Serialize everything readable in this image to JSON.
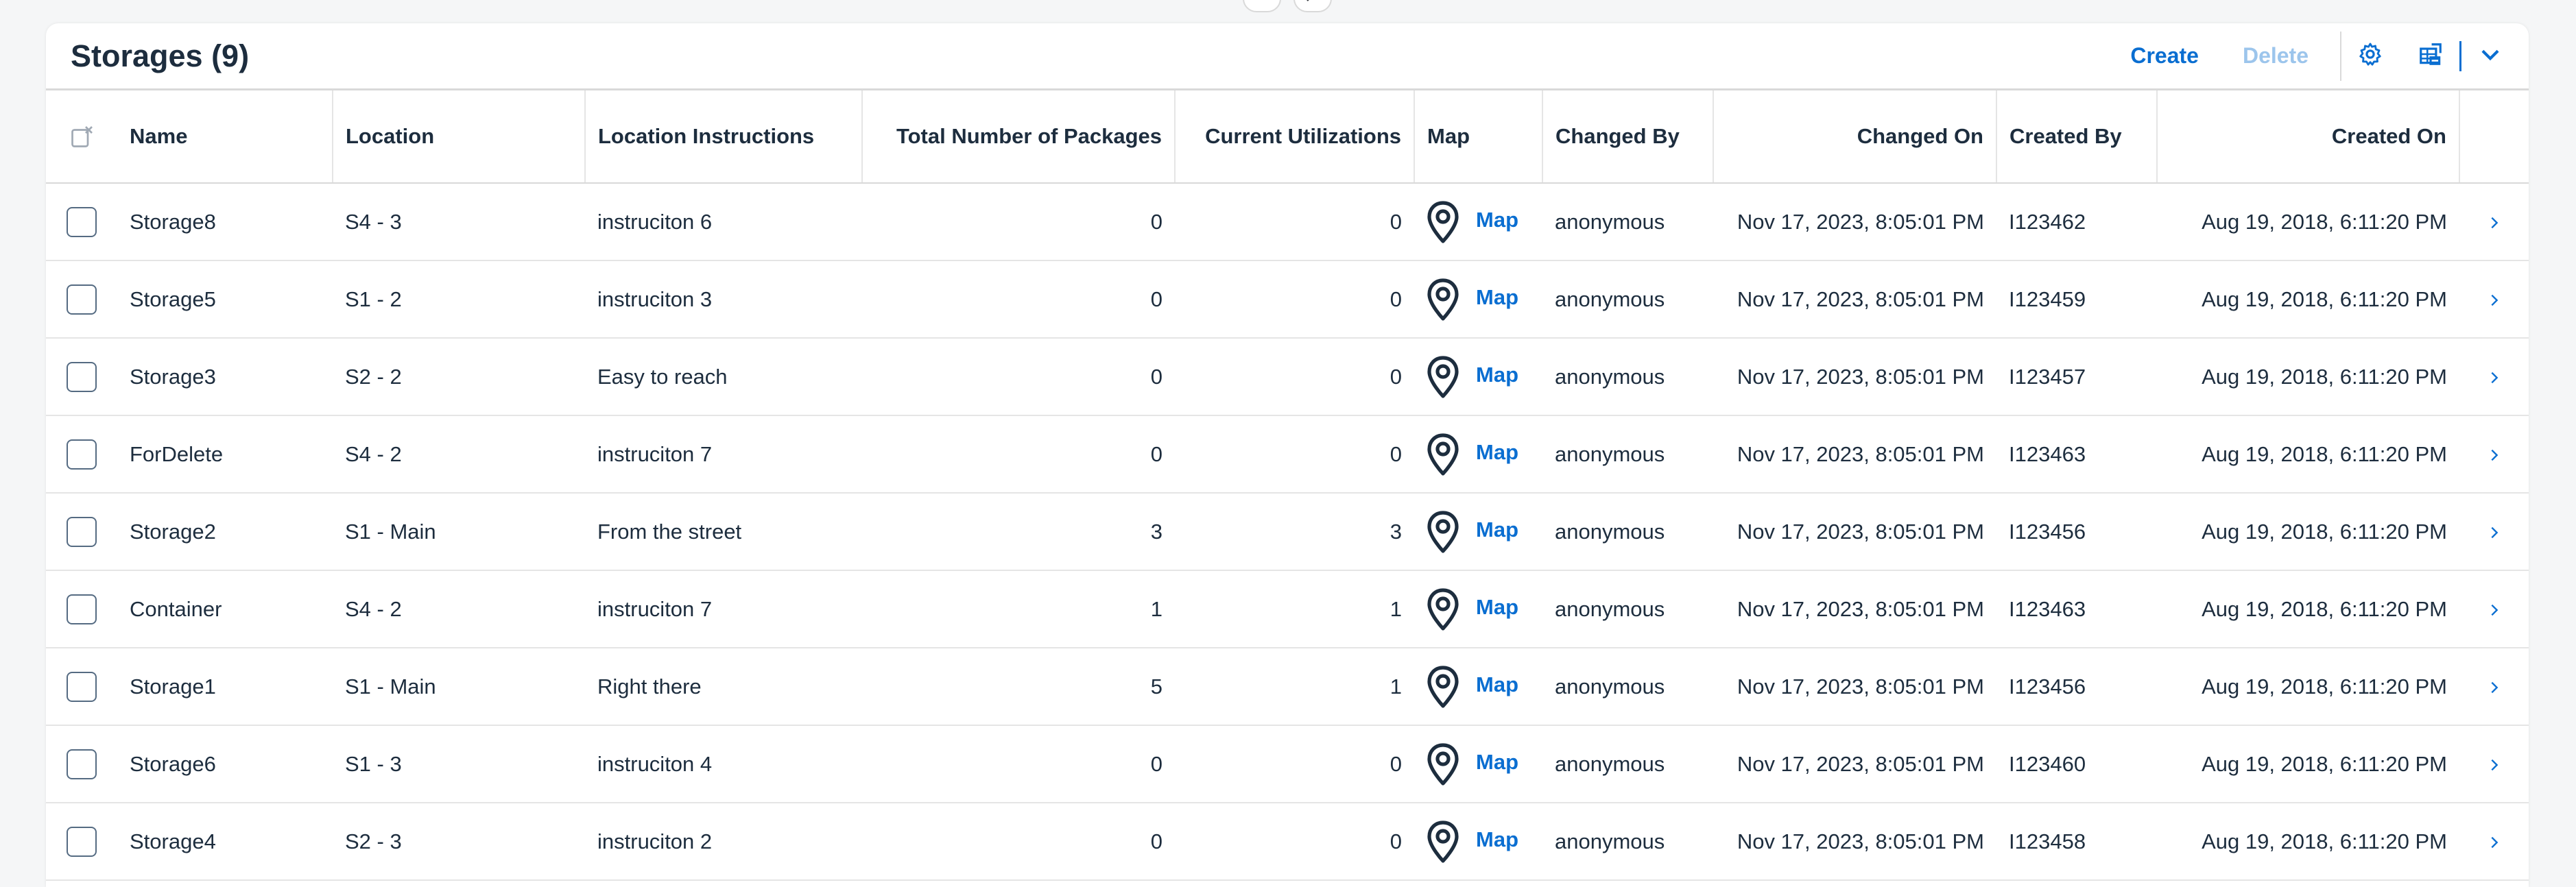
{
  "table": {
    "title": "Storages (9)",
    "toolbar": {
      "create_label": "Create",
      "delete_label": "Delete"
    },
    "columns": [
      "Name",
      "Location",
      "Location Instructions",
      "Total Number of Packages",
      "Current Utilizations",
      "Map",
      "Changed By",
      "Changed On",
      "Created By",
      "Created On"
    ],
    "rows": [
      {
        "name": "Storage8",
        "location": "S4 - 3",
        "instructions": "instruciton 6",
        "total": "0",
        "util": "0",
        "map": "Map",
        "changed_by": "anonymous",
        "changed_on": "Nov 17, 2023, 8:05:01 PM",
        "created_by": "I123462",
        "created_on": "Aug 19, 2018, 6:11:20 PM"
      },
      {
        "name": "Storage5",
        "location": "S1 - 2",
        "instructions": "instruciton 3",
        "total": "0",
        "util": "0",
        "map": "Map",
        "changed_by": "anonymous",
        "changed_on": "Nov 17, 2023, 8:05:01 PM",
        "created_by": "I123459",
        "created_on": "Aug 19, 2018, 6:11:20 PM"
      },
      {
        "name": "Storage3",
        "location": "S2 - 2",
        "instructions": "Easy to reach",
        "total": "0",
        "util": "0",
        "map": "Map",
        "changed_by": "anonymous",
        "changed_on": "Nov 17, 2023, 8:05:01 PM",
        "created_by": "I123457",
        "created_on": "Aug 19, 2018, 6:11:20 PM"
      },
      {
        "name": "ForDelete",
        "location": "S4 - 2",
        "instructions": "instruciton 7",
        "total": "0",
        "util": "0",
        "map": "Map",
        "changed_by": "anonymous",
        "changed_on": "Nov 17, 2023, 8:05:01 PM",
        "created_by": "I123463",
        "created_on": "Aug 19, 2018, 6:11:20 PM"
      },
      {
        "name": "Storage2",
        "location": "S1 - Main",
        "instructions": "From the street",
        "total": "3",
        "util": "3",
        "map": "Map",
        "changed_by": "anonymous",
        "changed_on": "Nov 17, 2023, 8:05:01 PM",
        "created_by": "I123456",
        "created_on": "Aug 19, 2018, 6:11:20 PM"
      },
      {
        "name": "Container",
        "location": "S4 - 2",
        "instructions": "instruciton 7",
        "total": "1",
        "util": "1",
        "map": "Map",
        "changed_by": "anonymous",
        "changed_on": "Nov 17, 2023, 8:05:01 PM",
        "created_by": "I123463",
        "created_on": "Aug 19, 2018, 6:11:20 PM"
      },
      {
        "name": "Storage1",
        "location": "S1 - Main",
        "instructions": "Right there",
        "total": "5",
        "util": "1",
        "map": "Map",
        "changed_by": "anonymous",
        "changed_on": "Nov 17, 2023, 8:05:01 PM",
        "created_by": "I123456",
        "created_on": "Aug 19, 2018, 6:11:20 PM"
      },
      {
        "name": "Storage6",
        "location": "S1 - 3",
        "instructions": "instruciton 4",
        "total": "0",
        "util": "0",
        "map": "Map",
        "changed_by": "anonymous",
        "changed_on": "Nov 17, 2023, 8:05:01 PM",
        "created_by": "I123460",
        "created_on": "Aug 19, 2018, 6:11:20 PM"
      },
      {
        "name": "Storage4",
        "location": "S2 - 3",
        "instructions": "instruciton 2",
        "total": "0",
        "util": "0",
        "map": "Map",
        "changed_by": "anonymous",
        "changed_on": "Nov 17, 2023, 8:05:01 PM",
        "created_by": "I123458",
        "created_on": "Aug 19, 2018, 6:11:20 PM"
      }
    ]
  },
  "icons": {
    "header_collapse": "collapse-header-icon",
    "header_pin": "pin-header-icon",
    "settings": "gear-icon",
    "export": "export-spreadsheet-icon",
    "export_menu": "chevron-down-icon",
    "select_all": "clear-selection-icon",
    "map_pin": "map-pin-icon",
    "row_nav": "chevron-right-icon"
  },
  "colors": {
    "accent": "#0a6ed1",
    "disabled_action": "#9cc5ec",
    "text": "#1d2d3e",
    "background": "#f5f6f7"
  }
}
